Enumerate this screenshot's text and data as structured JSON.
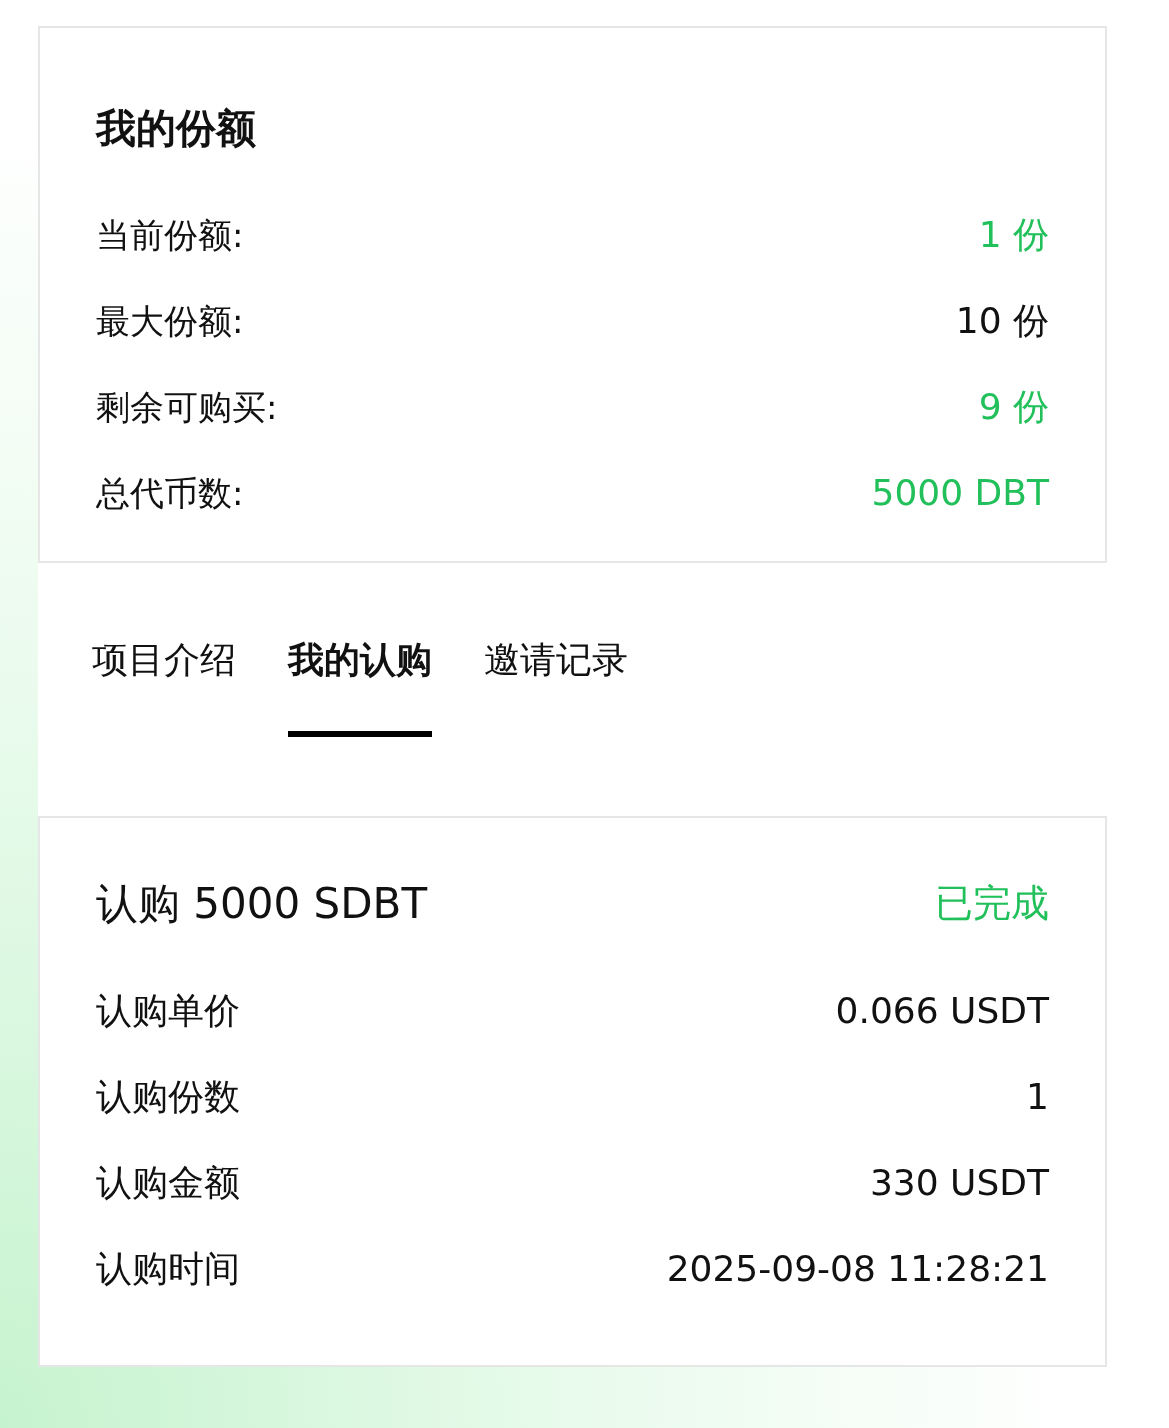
{
  "shares": {
    "title": "我的份额",
    "rows": [
      {
        "label": "当前份额:",
        "value": "1 份",
        "color": "#22c05a"
      },
      {
        "label": "最大份额:",
        "value": "10 份",
        "color": "#111111"
      },
      {
        "label": "剩余可购买:",
        "value": "9 份",
        "color": "#22c05a"
      },
      {
        "label": "总代币数:",
        "value": "5000 DBT",
        "color": "#22c05a"
      }
    ]
  },
  "tabs": [
    {
      "label": "项目介绍",
      "selected": false
    },
    {
      "label": "我的认购",
      "selected": true
    },
    {
      "label": "邀请记录",
      "selected": false
    }
  ],
  "subscription": {
    "title": "认购 5000 SDBT",
    "status": "已完成",
    "rows": [
      {
        "label": "认购单价",
        "value": "0.066 USDT"
      },
      {
        "label": "认购份数",
        "value": "1"
      },
      {
        "label": "认购金额",
        "value": "330 USDT"
      },
      {
        "label": "认购时间",
        "value": "2025-09-08 11:28:21"
      }
    ]
  }
}
